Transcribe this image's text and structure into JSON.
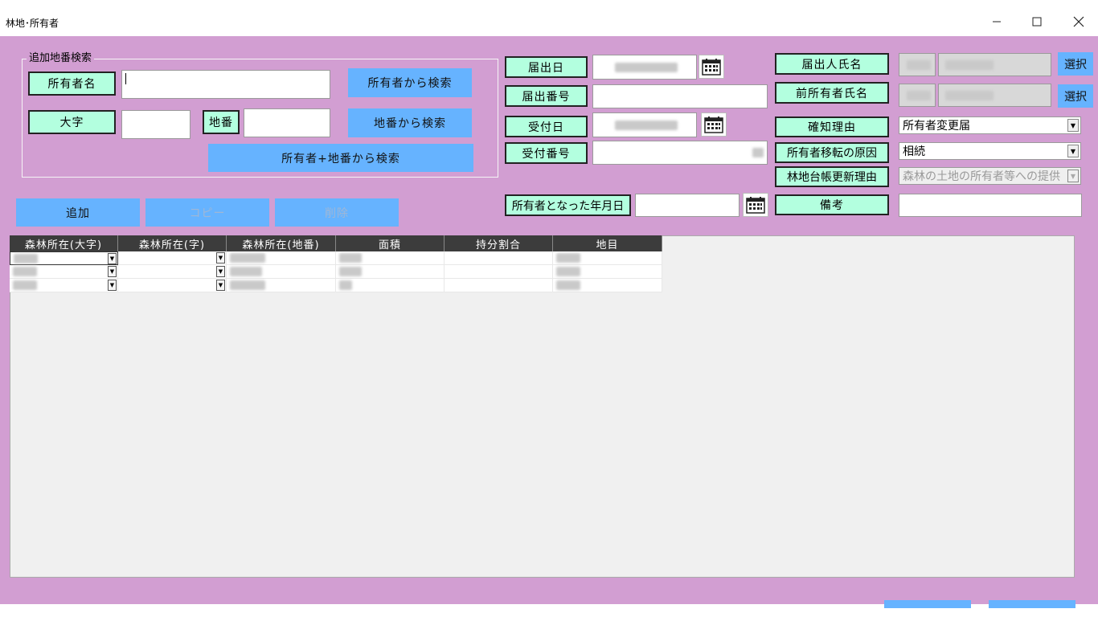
{
  "window": {
    "title": "林地･所有者"
  },
  "search_group": {
    "legend": "追加地番検索",
    "owner_label": "所有者名",
    "oaza_label": "大字",
    "chiban_label": "地番",
    "search_by_owner": "所有者から検索",
    "search_by_chiban": "地番から検索",
    "search_by_both": "所有者+地番から検索"
  },
  "actions": {
    "add": "追加",
    "copy": "コピー",
    "delete": "削除"
  },
  "middle": {
    "todokede_date_label": "届出日",
    "todokede_no_label": "届出番号",
    "uketsuke_date_label": "受付日",
    "uketsuke_no_label": "受付番号",
    "became_owner_label": "所有者となった年月日"
  },
  "right": {
    "applicant_label": "届出人氏名",
    "prev_owner_label": "前所有者氏名",
    "select_btn": "選択",
    "reason_label": "確知理由",
    "reason_value": "所有者変更届",
    "cause_label": "所有者移転の原因",
    "cause_value": "相続",
    "update_reason_label": "林地台帳更新理由",
    "update_reason_value": "森林の土地の所有者等への提供",
    "remarks_label": "備考"
  },
  "grid": {
    "columns": [
      "森林所在(大字)",
      "森林所在(字)",
      "森林所在(地番)",
      "面積",
      "持分割合",
      "地目"
    ],
    "row_count": 3
  },
  "colors": {
    "background": "#d29ed2",
    "label_bg": "#b3ffdf",
    "button_bg": "#66b3ff",
    "grid_header": "#3c3c3c"
  }
}
